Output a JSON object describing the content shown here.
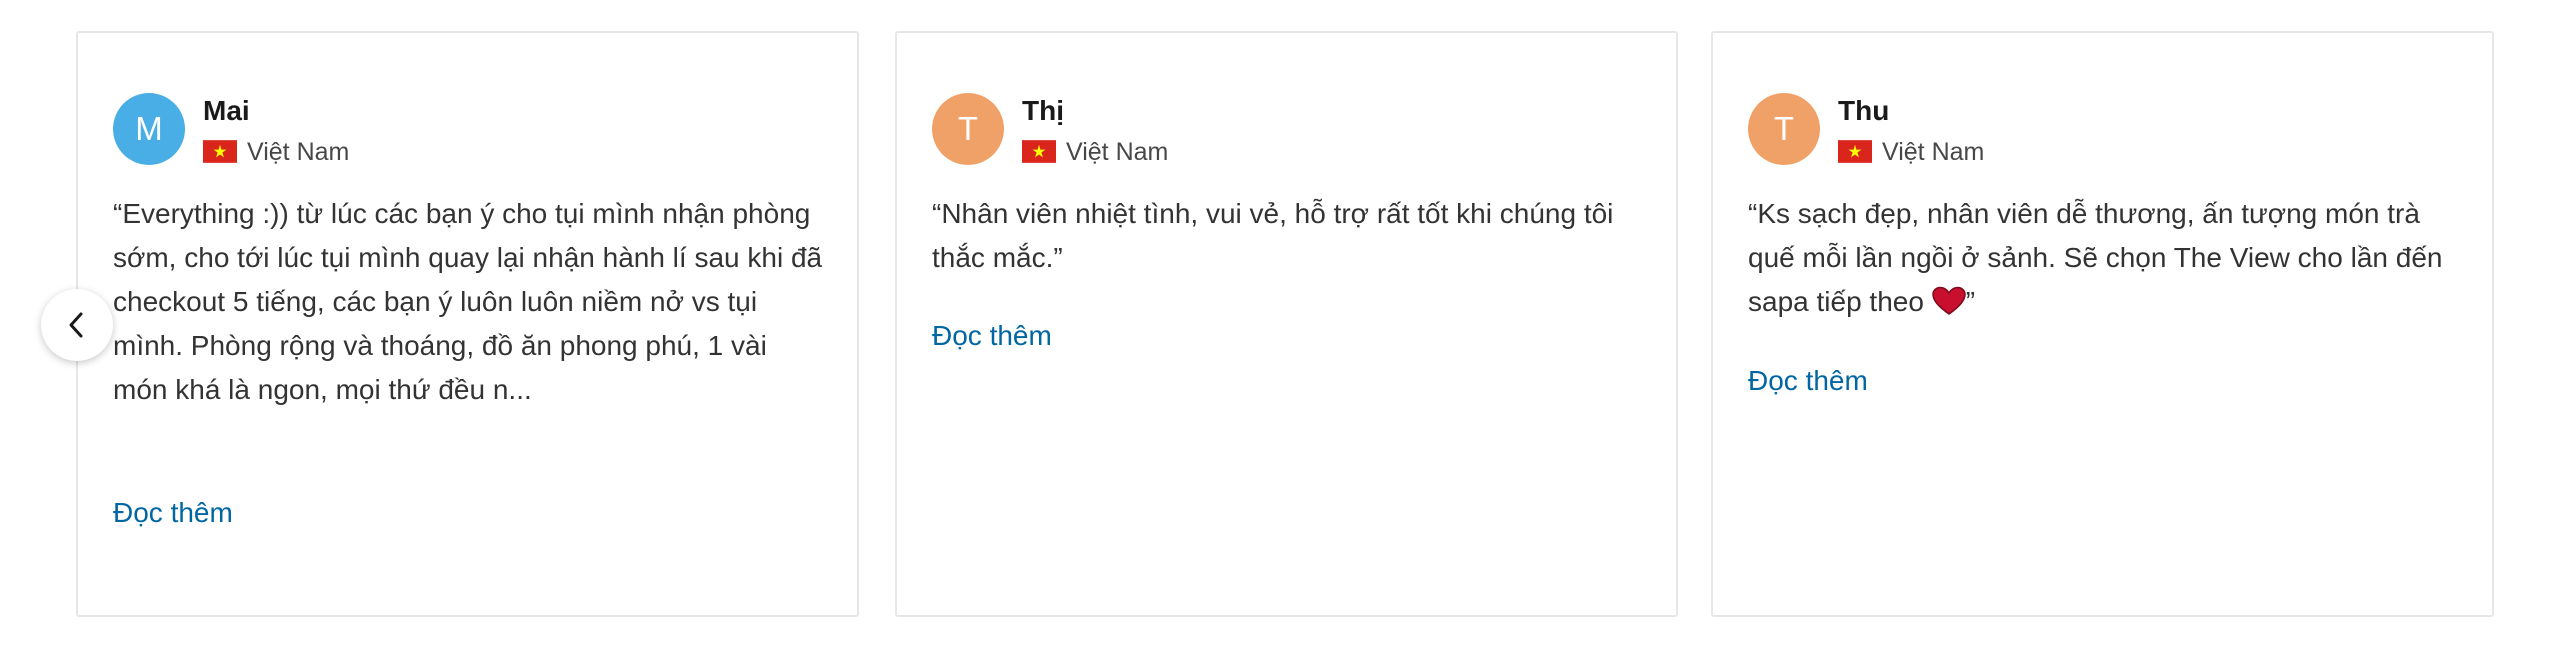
{
  "reviews": [
    {
      "initial": "M",
      "avatar_color": "#4aaee6",
      "name": "Mai",
      "country": "Việt Nam",
      "text": "“Everything :)) từ lúc các bạn ý cho tụi mình nhận phòng sớm, cho tới lúc tụi mình quay lại nhận hành lí sau khi đã checkout 5 tiếng, các bạn ý luôn luôn niềm nở vs tụi mình. Phòng rộng và thoáng, đồ ăn phong phú, 1 vài món khá là ngon, mọi thứ đều n...",
      "read_more": "Đọc thêm"
    },
    {
      "initial": "T",
      "avatar_color": "#f0a167",
      "name": "Thị",
      "country": "Việt Nam",
      "text": "“Nhân viên nhiệt tình, vui vẻ, hỗ trợ rất tốt khi chúng tôi thắc mắc.”",
      "read_more": "Đọc thêm"
    },
    {
      "initial": "T",
      "avatar_color": "#f0a167",
      "name": "Thu",
      "country": "Việt Nam",
      "text": "“Ks sạch đẹp, nhân viên dễ thương, ấn tượng món trà quế mỗi lần ngồi ở sảnh. Sẽ chọn The View cho lần đến sapa tiếp theo ",
      "text_end": "”",
      "read_more": "Đọc thêm"
    }
  ],
  "icons": {
    "flag": "vietnam-flag-icon",
    "heart": "red-heart-icon",
    "prev": "chevron-left-icon"
  },
  "colors": {
    "link": "#0067a3",
    "flag_red": "#da251d",
    "flag_star": "#ffff00",
    "heart": "#c8102e",
    "card_border": "#e7e7e7"
  }
}
